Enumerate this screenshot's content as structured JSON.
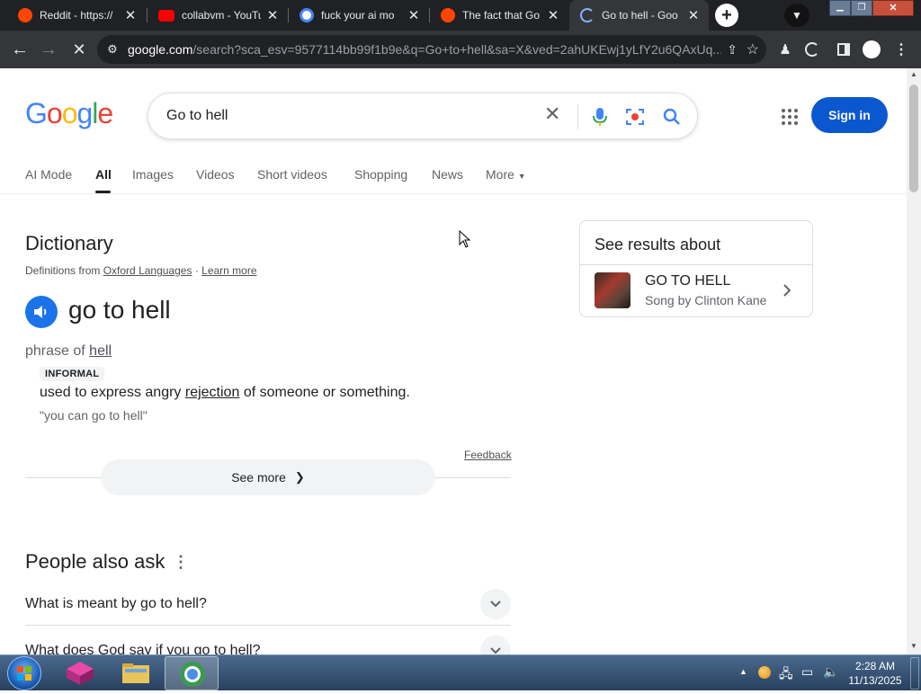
{
  "browser": {
    "tabs": [
      {
        "title": "Reddit - https://",
        "favicon": "reddit-icon",
        "active": false
      },
      {
        "title": "collabvm - YouTube",
        "favicon": "youtube-icon",
        "active": false
      },
      {
        "title": "fuck your ai mo",
        "favicon": "google-icon",
        "active": false
      },
      {
        "title": "The fact that Go",
        "favicon": "reddit-icon",
        "active": false
      },
      {
        "title": "Go to hell - Goo",
        "favicon": "loading-icon",
        "active": true
      }
    ],
    "url_domain": "google.com",
    "url_rest": "/search?sca_esv=9577114bb99f1b9e&q=Go+to+hell&sa=X&ved=2ahUKEwj1yLfY2u6QAxUq..."
  },
  "google": {
    "logo_letters": [
      "G",
      "o",
      "o",
      "g",
      "l",
      "e"
    ],
    "logo_colors": [
      "#4285f4",
      "#ea4335",
      "#fbbc05",
      "#4285f4",
      "#34a853",
      "#ea4335"
    ],
    "query": "Go to hell",
    "sign_in": "Sign in",
    "nav": [
      "AI Mode",
      "All",
      "Images",
      "Videos",
      "Short videos",
      "Shopping",
      "News",
      "More"
    ],
    "active_nav": "All"
  },
  "dictionary": {
    "heading": "Dictionary",
    "source_prefix": "Definitions from",
    "source": "Oxford Languages",
    "separator": "·",
    "learn_more": "Learn more",
    "word": "go to hell",
    "pos_prefix": "phrase of",
    "pos_link": "hell",
    "register": "INFORMAL",
    "def_before": "used to express angry",
    "def_link": "rejection",
    "def_after": "of someone or something.",
    "example": "\"you can go to hell\"",
    "feedback": "Feedback",
    "see_more": "See more"
  },
  "side_panel": {
    "heading": "See results about",
    "title": "GO TO HELL",
    "subtitle": "Song by Clinton Kane"
  },
  "paa": {
    "heading": "People also ask",
    "questions": [
      "What is meant by go to hell?",
      "What does God say if you go to hell?"
    ]
  },
  "taskbar": {
    "time": "2:28 AM",
    "date": "11/13/2025"
  }
}
